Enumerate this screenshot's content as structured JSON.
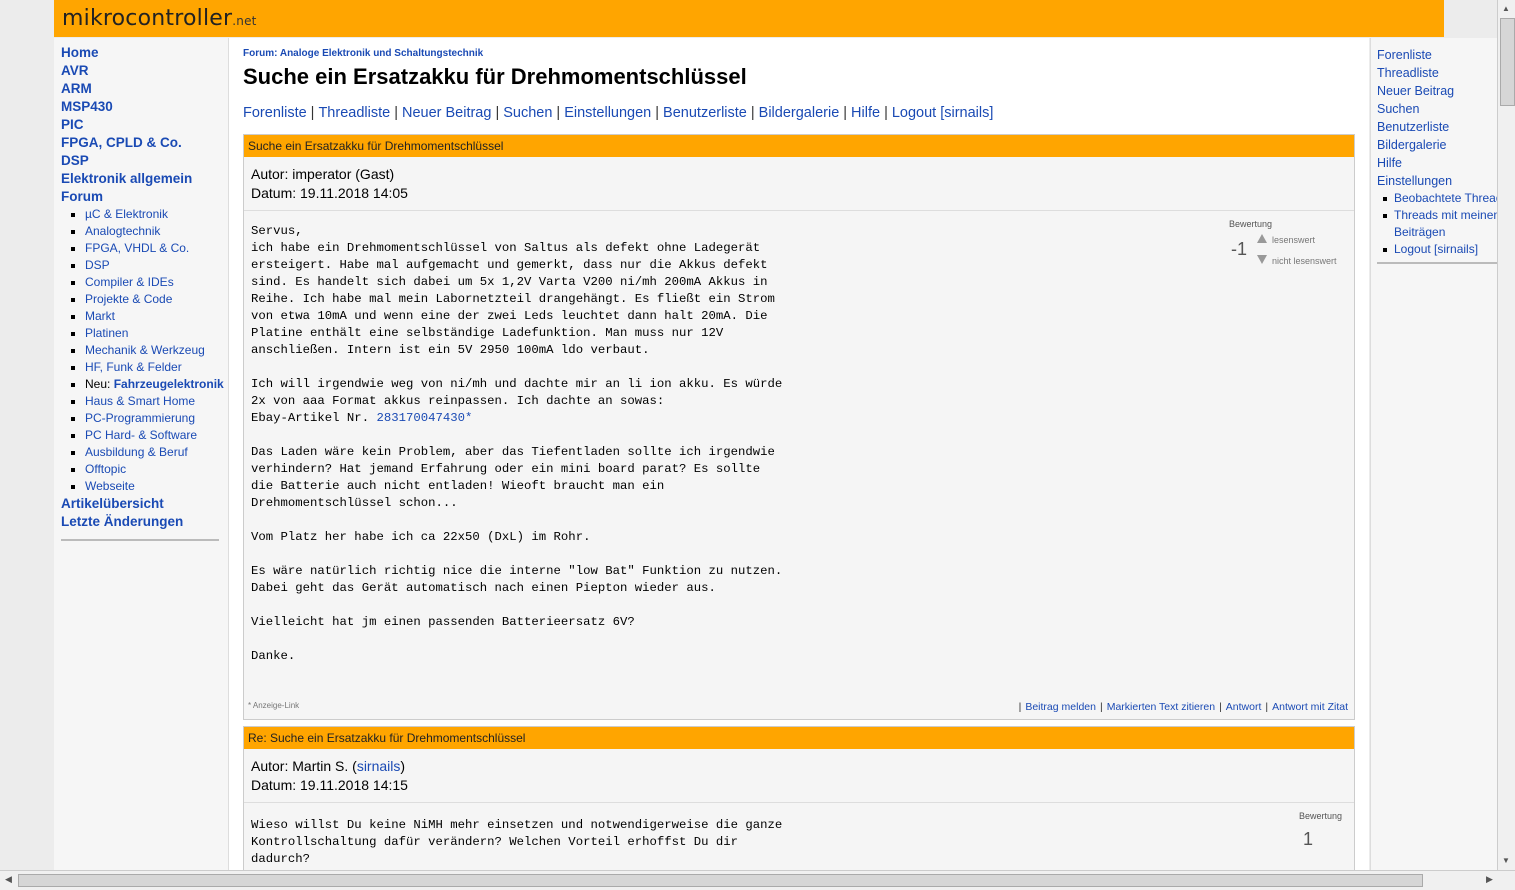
{
  "header": {
    "logo_main": "mikrocontroller",
    "logo_suffix": ".net"
  },
  "leftnav": {
    "items": [
      "Home",
      "AVR",
      "ARM",
      "MSP430",
      "PIC",
      "FPGA, CPLD & Co.",
      "DSP",
      "Elektronik allgemein",
      "Forum"
    ],
    "forum_sub": [
      "µC & Elektronik",
      "Analogtechnik",
      "FPGA, VHDL & Co.",
      "DSP",
      "Compiler & IDEs",
      "Projekte & Code",
      "Markt",
      "Platinen",
      "Mechanik & Werkzeug",
      "HF, Funk & Felder",
      "Neu: Fahrzeugelektronik",
      "Haus & Smart Home",
      "PC-Programmierung",
      "PC Hard- & Software",
      "Ausbildung & Beruf",
      "Offtopic",
      "Webseite"
    ],
    "new_prefix": "Neu: ",
    "new_label": "Fahrzeugelektronik",
    "bottom_items": [
      "Artikelübersicht",
      "Letzte Änderungen"
    ]
  },
  "main": {
    "breadcrumb": "Forum: Analoge Elektronik und Schaltungstechnik",
    "title": "Suche ein Ersatzakku für Drehmomentschlüssel",
    "nav": [
      "Forenliste",
      "Threadliste",
      "Neuer Beitrag",
      "Suchen",
      "Einstellungen",
      "Benutzerliste",
      "Bildergalerie",
      "Hilfe",
      "Logout [sirnails]"
    ],
    "sep": "|"
  },
  "post1": {
    "subject": "Suche ein Ersatzakku für Drehmomentschlüssel",
    "author": "Autor: imperator (Gast)",
    "date": "Datum: 19.11.2018 14:05",
    "rating_label": "Bewertung",
    "rating_score": "-1",
    "rating_up": "lesenswert",
    "rating_down": "nicht lesenswert",
    "text_a": "Servus,\nich habe ein Drehmomentschlüssel von Saltus als defekt ohne Ladegerät\nersteigert. Habe mal aufgemacht und gemerkt, dass nur die Akkus defekt\nsind. Es handelt sich dabei um 5x 1,2V Varta V200 ni/mh 200mA Akkus in\nReihe. Ich habe mal mein Labornetzteil drangehängt. Es fließt ein Strom\nvon etwa 10mA und wenn eine der zwei Leds leuchtet dann halt 20mA. Die\nPlatine enthält eine selbständige Ladefunktion. Man muss nur 12V\nanschließen. Intern ist ein 5V 2950 100mA ldo verbaut.\n\nIch will irgendwie weg von ni/mh und dachte mir an li ion akku. Es würde\n2x von aaa Format akkus reinpassen. Ich dachte an sowas:\nEbay-Artikel Nr. ",
    "ebay_link": "283170047430*",
    "text_b": "\n\nDas Laden wäre kein Problem, aber das Tiefentladen sollte ich irgendwie\nverhindern? Hat jemand Erfahrung oder ein mini board parat? Es sollte\ndie Batterie auch nicht entladen! Wieoft braucht man ein\nDrehmomentschlüssel schon...\n\nVom Platz her habe ich ca 22x50 (DxL) im Rohr.\n\nEs wäre natürlich richtig nice die interne \"low Bat\" Funktion zu nutzen.\nDabei geht das Gerät automatisch nach einen Piepton wieder aus.\n\nVielleicht hat jm einen passenden Batterieersatz 6V?\n\nDanke.",
    "anzeige": "* Anzeige-Link",
    "actions": [
      "Beitrag melden",
      "Markierten Text zitieren",
      "Antwort",
      "Antwort mit Zitat"
    ]
  },
  "post2": {
    "subject": "Re: Suche ein Ersatzakku für Drehmomentschlüssel",
    "author_prefix": "Autor: Martin S. (",
    "author_link": "sirnails",
    "author_suffix": ")",
    "date": "Datum: 19.11.2018 14:15",
    "rating_label": "Bewertung",
    "rating_score": "1",
    "text": "Wieso willst Du keine NiMH mehr einsetzen und notwendigerweise die ganze\nKontrollschaltung dafür verändern? Welchen Vorteil erhoffst Du dir\ndadurch?"
  },
  "rightnav": {
    "items": [
      "Forenliste",
      "Threadliste",
      "Neuer Beitrag",
      "Suchen",
      "Benutzerliste",
      "Bildergalerie",
      "Hilfe",
      "Einstellungen"
    ],
    "sub": [
      "Beobachtete Threads",
      "Threads mit meinen",
      "Beiträgen",
      "Logout [sirnails]"
    ]
  },
  "colors": {
    "accent": "#ffa500",
    "link": "#1a4ab4"
  }
}
